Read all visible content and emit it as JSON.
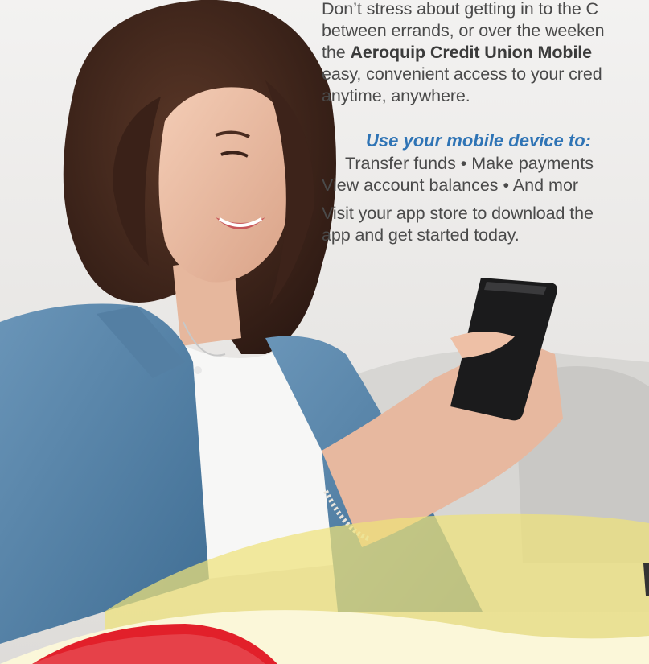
{
  "ad": {
    "intro_before": "Don’t stress about getting in to the C",
    "intro_line2": "between errands, or over the weeken",
    "intro_line3_prefix": "the ",
    "intro_brand": "Aeroquip Credit Union Mobile",
    "intro_line4": "easy, convenient access to your cred",
    "intro_line5": "anytime, anywhere.",
    "subhead": "Use your mobile device to:",
    "features_line1": "Transfer funds  •  Make payments",
    "features_line2": "View account balances  •  And mor",
    "outro_line1": "Visit your app store to download the",
    "outro_line2": "app and get started today."
  },
  "colors": {
    "subhead": "#2f74b5",
    "body_text": "#4a4a4a",
    "accent_yellow": "#efe27a",
    "accent_red": "#e2202a",
    "denim": "#5b86a8"
  },
  "image": {
    "subject": "smiling woman in denim shirt using smartphone on a couch"
  }
}
